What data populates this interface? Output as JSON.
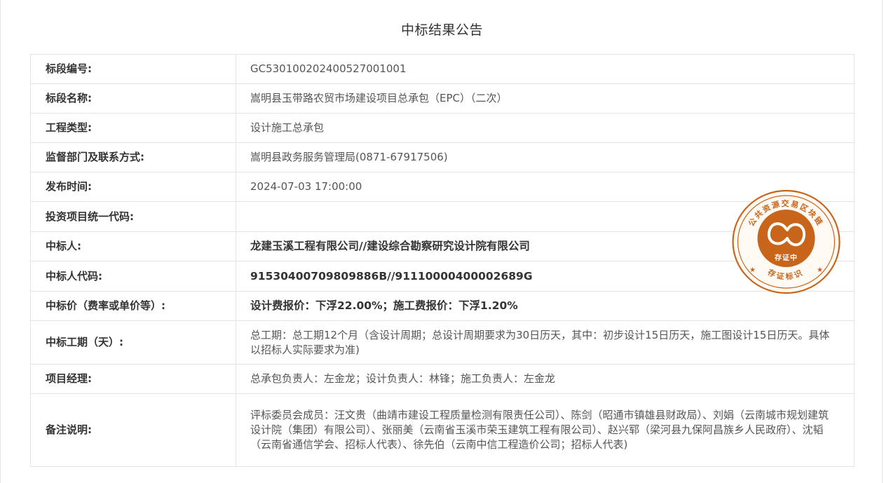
{
  "title": "中标结果公告",
  "rows": [
    {
      "label": "标段编号:",
      "value": "GC5301002024005270010 01"
    },
    {
      "label": "标段名称:",
      "value": "嵩明县玉带路农贸市场建设项目总承包（EPC）（二次）"
    },
    {
      "label": "工程类型:",
      "value": "设计施工总承包"
    },
    {
      "label": "监督部门及联系方式:",
      "value": "嵩明县政务服务管理局(0871-67917506)"
    },
    {
      "label": "发布时间:",
      "value": "2024-07-03 17:00:00"
    },
    {
      "label": "投资项目统一代码:",
      "value": ""
    },
    {
      "label": "中标人:",
      "value": "龙建玉溪工程有限公司//建设综合勘察研究设计院有限公司"
    },
    {
      "label": "中标人代码:",
      "value": "91530400709809886B//91110000400002689G"
    },
    {
      "label": "中标价（费率或单价等）:",
      "value": "设计费报价：下浮22.00%；施工费报价：下浮1.20%"
    },
    {
      "label": "中标工期（天）:",
      "value": "总工期：总工期12个月（含设计周期；总设计周期要求为30日历天，其中：初步设计15日历天，施工图设计15日历天。具体以招标人实际要求为准)"
    },
    {
      "label": "项目经理:",
      "value": "总承包负责人：左金龙；设计负责人：林锋；施工负责人：左金龙"
    },
    {
      "label": "备注说明:",
      "value": "评标委员会成员：汪文贵（曲靖市建设工程质量检测有限责任公司）、陈剑（昭通市镇雄县财政局）、刘娟（云南城市规划建筑设计院（集团）有限公司）、张丽美（云南省玉溪市荣玉建筑工程有限公司）、赵兴郓（梁河县九保阿昌族乡人民政府）、沈韬（云南省通信学会、招标人代表）、徐先伯（云南中信工程造价公司；招标人代表)"
    }
  ],
  "seal": {
    "ring_text": "公共资源交易区块链",
    "center_text": "存证中",
    "bottom_text": "存证标识",
    "color": "#c8651b"
  }
}
